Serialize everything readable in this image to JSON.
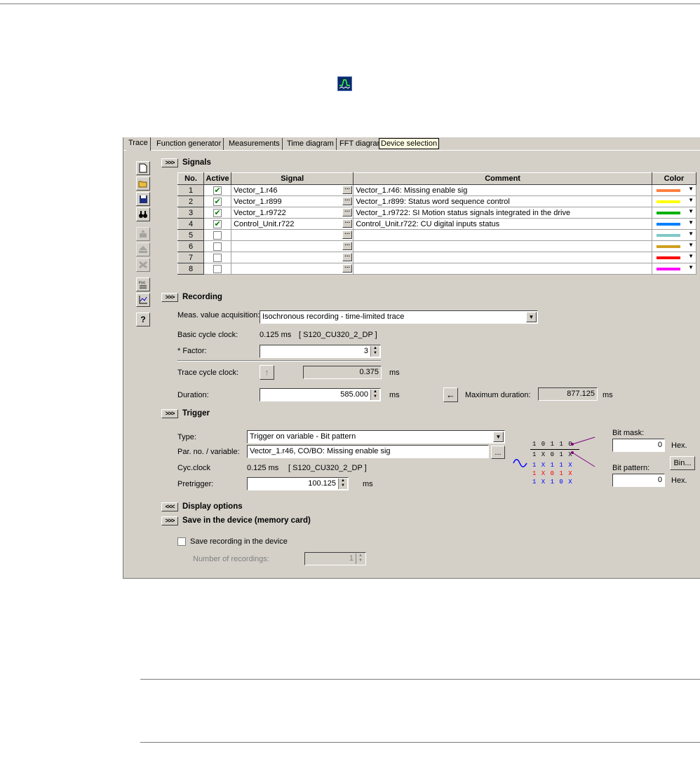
{
  "tabs": [
    "Trace",
    "Function generator",
    "Measurements",
    "Time diagram",
    "FFT diagram"
  ],
  "tooltip": "Device selection",
  "signals": {
    "title": "Signals",
    "expander": ">>>",
    "columns": [
      "No.",
      "Active",
      "Signal",
      "Comment",
      "Color"
    ],
    "rows": [
      {
        "no": "1",
        "active": true,
        "signal": "Vector_1.r46",
        "comment": "Vector_1.r46: Missing enable sig",
        "color": "#ff8040"
      },
      {
        "no": "2",
        "active": true,
        "signal": "Vector_1.r899",
        "comment": "Vector_1.r899: Status word sequence control",
        "color": "#ffff00"
      },
      {
        "no": "3",
        "active": true,
        "signal": "Vector_1.r9722",
        "comment": "Vector_1.r9722: SI Motion status signals integrated in the drive",
        "color": "#00b000"
      },
      {
        "no": "4",
        "active": true,
        "signal": "Control_Unit.r722",
        "comment": "Control_Unit.r722: CU digital inputs status",
        "color": "#0080ff"
      },
      {
        "no": "5",
        "active": false,
        "signal": "",
        "comment": "",
        "color": "#80c8c8"
      },
      {
        "no": "6",
        "active": false,
        "signal": "",
        "comment": "",
        "color": "#d0a020"
      },
      {
        "no": "7",
        "active": false,
        "signal": "",
        "comment": "",
        "color": "#ff0000"
      },
      {
        "no": "8",
        "active": false,
        "signal": "",
        "comment": "",
        "color": "#ff00ff"
      }
    ]
  },
  "recording": {
    "title": "Recording",
    "expander": ">>>",
    "acq_label": "Meas. value acquisition:",
    "acq_value": "Isochronous recording - time-limited trace",
    "basic_cycle_label": "Basic cycle clock:",
    "basic_cycle_value": "0.125 ms",
    "basic_cycle_device": "[ S120_CU320_2_DP ]",
    "factor_label": "* Factor:",
    "factor_value": "3",
    "trace_cycle_label": "Trace cycle clock:",
    "trace_cycle_value": "0.375",
    "trace_cycle_unit": "ms",
    "duration_label": "Duration:",
    "duration_value": "585.000",
    "duration_unit": "ms",
    "max_duration_label": "Maximum duration:",
    "max_duration_value": "877.125",
    "max_duration_unit": "ms"
  },
  "trigger": {
    "title": "Trigger",
    "expander": ">>>",
    "type_label": "Type:",
    "type_value": "Trigger on variable - Bit pattern",
    "par_label": "Par. no. / variable:",
    "par_value": "Vector_1.r46, CO/BO: Missing enable sig",
    "par_button": "...",
    "cyc_label": "Cyc.clock",
    "cyc_value": "0.125 ms",
    "cyc_device": "[ S120_CU320_2_DP ]",
    "pretrigger_label": "Pretrigger:",
    "pretrigger_value": "100.125",
    "pretrigger_unit": "ms",
    "bitmask_label": "Bit mask:",
    "bitmask_value": "0",
    "bitmask_unit": "Hex.",
    "bin_button": "Bin...",
    "bitpattern_label": "Bit pattern:",
    "bitpattern_value": "0",
    "bitpattern_unit": "Hex.",
    "diagram": {
      "line1": "1 0 1 1 0",
      "line2": "1 X 0 1 X",
      "line3": "1 X 1 1 X",
      "line4": "1 X 0 1 X",
      "line5": "1 X 1 0 X"
    }
  },
  "display_options": {
    "title": "Display options",
    "expander": "<<<"
  },
  "save_device": {
    "title": "Save in the device (memory card)",
    "expander": ">>>",
    "checkbox_label": "Save recording in the device",
    "num_label": "Number of recordings:",
    "num_value": "1"
  },
  "toolbar_icons": [
    "new-file-icon",
    "open-folder-icon",
    "save-disk-icon",
    "binoculars-icon",
    "upload-icon",
    "eject-icon",
    "delete-icon",
    "formula-icon",
    "chart-icon",
    "help-icon"
  ]
}
